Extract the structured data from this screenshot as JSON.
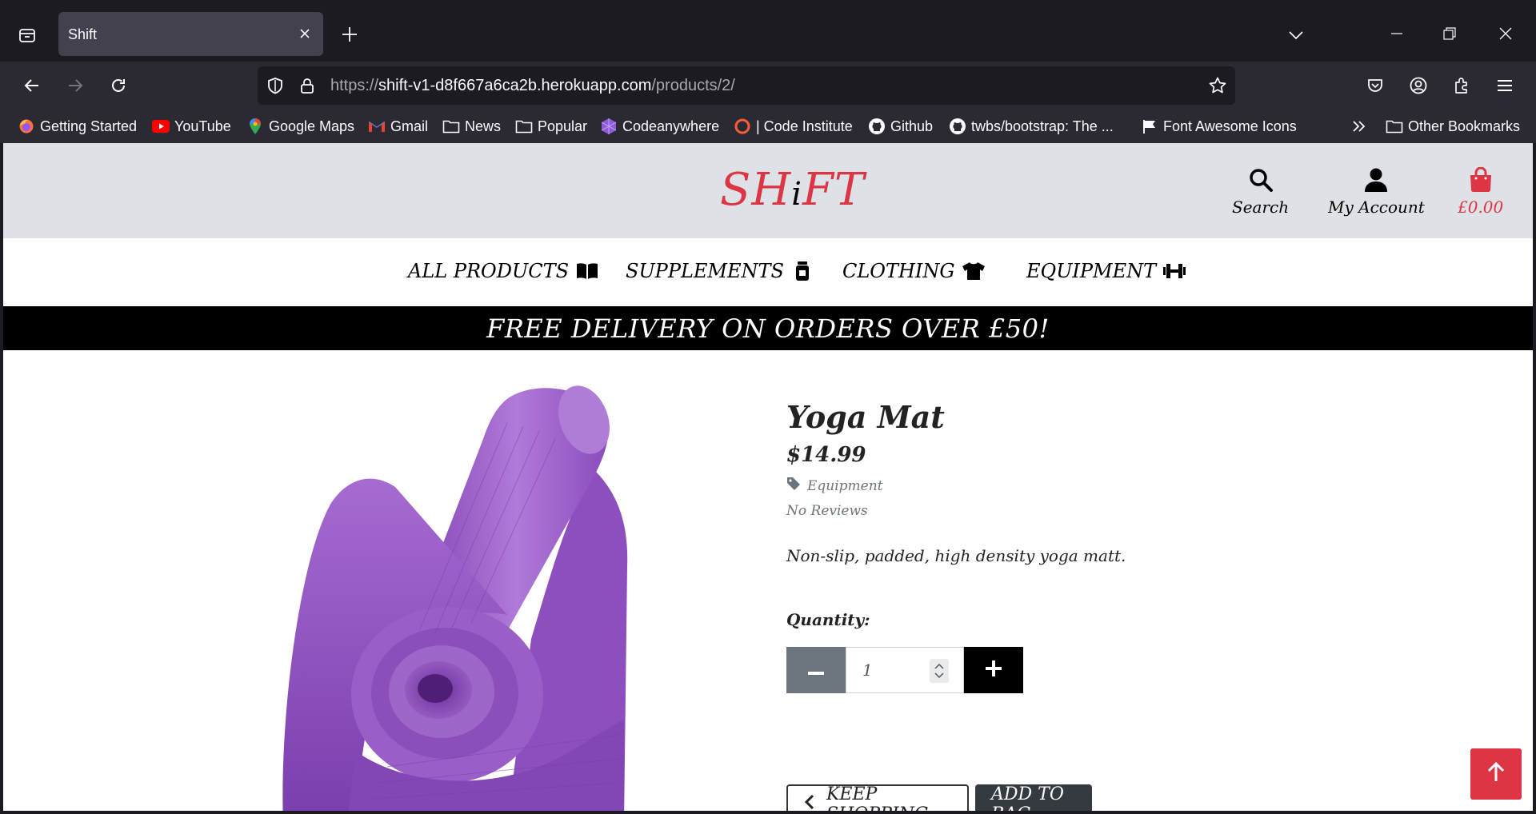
{
  "browser": {
    "tab": {
      "title": "Shift"
    },
    "url": {
      "scheme": "https://",
      "host": "shift-v1-d8f667a6ca2b.herokuapp.com",
      "path": "/products/2/"
    },
    "bookmarks": [
      {
        "label": "Getting Started",
        "icon": "firefox-icon"
      },
      {
        "label": "YouTube",
        "icon": "youtube-icon"
      },
      {
        "label": "Google Maps",
        "icon": "google-maps-icon"
      },
      {
        "label": "Gmail",
        "icon": "gmail-icon"
      },
      {
        "label": "News",
        "icon": "folder-icon"
      },
      {
        "label": "Popular",
        "icon": "folder-icon"
      },
      {
        "label": "Codeanywhere",
        "icon": "codeanywhere-icon"
      },
      {
        "label": "| Code Institute",
        "icon": "code-institute-icon"
      },
      {
        "label": "Github",
        "icon": "github-icon"
      },
      {
        "label": "twbs/bootstrap: The ...",
        "icon": "github-icon"
      },
      {
        "label": "Font Awesome Icons",
        "icon": "font-awesome-icon"
      }
    ],
    "other_bookmarks": "Other Bookmarks"
  },
  "site": {
    "logo": {
      "part1": "SH",
      "part2": "i",
      "part3": "FT"
    },
    "header": {
      "search_label": "Search",
      "account_label": "My Account",
      "bag_total": "£0.00"
    },
    "nav": [
      {
        "label": "ALL PRODUCTS",
        "icon": "book-open-icon"
      },
      {
        "label": "SUPPLEMENTS",
        "icon": "supplement-jar-icon"
      },
      {
        "label": "CLOTHING",
        "icon": "tshirt-icon"
      },
      {
        "label": "EQUIPMENT",
        "icon": "dumbbell-icon"
      }
    ],
    "banner": "FREE DELIVERY ON ORDERS OVER £50!"
  },
  "product": {
    "name": "Yoga Mat",
    "price": "$14.99",
    "category": "Equipment",
    "reviews": "No Reviews",
    "description": "Non-slip, padded, high density yoga matt.",
    "quantity_label": "Quantity:",
    "quantity": "1",
    "keep_shopping": "KEEP SHOPPING",
    "add_to_bag": "ADD TO BAG"
  },
  "colors": {
    "brand_red": "#dc3545",
    "header_bg": "#dee2e6",
    "mat_purple": "#9b59c9"
  }
}
